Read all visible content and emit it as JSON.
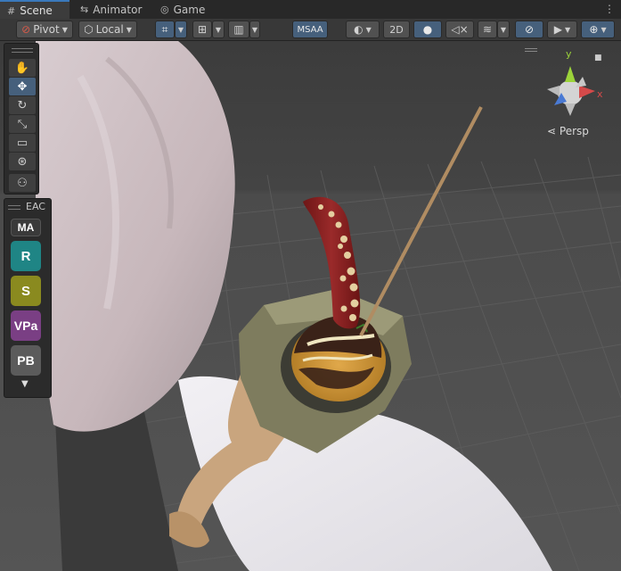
{
  "tabs": [
    {
      "label": "Scene",
      "icon": "hash-grid-icon"
    },
    {
      "label": "Animator",
      "icon": "animator-icon"
    },
    {
      "label": "Game",
      "icon": "gamepad-icon"
    }
  ],
  "toolbar": {
    "pivot_label": "Pivot",
    "local_label": "Local",
    "msaa_label": "MSAA",
    "mode_2d_label": "2D"
  },
  "tools": [
    "hand-icon",
    "move-icon",
    "rotate-icon",
    "scale-icon",
    "rect-icon",
    "transform-icon",
    "custom-tool-icon"
  ],
  "eac": {
    "title": "EAC",
    "buttons": [
      {
        "label": "MA",
        "color": "#3a3a3a"
      },
      {
        "label": "R",
        "color": "#1f8585"
      },
      {
        "label": "S",
        "color": "#8a8a1f"
      },
      {
        "label": "VPa",
        "color": "#7a3f84"
      },
      {
        "label": "PB",
        "color": "#5b5b5b"
      }
    ]
  },
  "gizmo": {
    "axis_x": "x",
    "axis_y": "y",
    "projection_label": "Persp"
  },
  "colors": {
    "accent": "#3a79bb",
    "toggle_on": "#46607c",
    "axis_x": "#d44a4a",
    "axis_y": "#9cd43a",
    "axis_z": "#4a7ad4"
  }
}
